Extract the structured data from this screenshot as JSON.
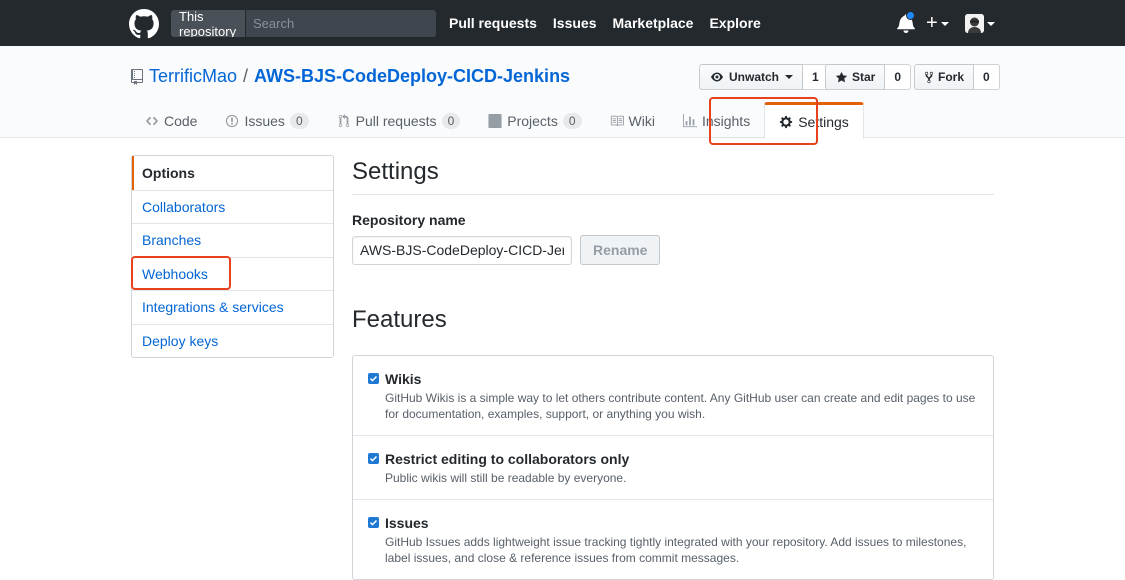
{
  "header": {
    "search_scope": "This repository",
    "search_placeholder": "Search",
    "nav": [
      "Pull requests",
      "Issues",
      "Marketplace",
      "Explore"
    ],
    "plus_label": "+"
  },
  "repo": {
    "owner": "TerrificMao",
    "separator": "/",
    "name": "AWS-BJS-CodeDeploy-CICD-Jenkins",
    "unwatch_label": "Unwatch",
    "watch_count": "1",
    "star_label": "Star",
    "star_count": "0",
    "fork_label": "Fork",
    "fork_count": "0"
  },
  "reponav": {
    "code": "Code",
    "issues": "Issues",
    "issues_count": "0",
    "pulls": "Pull requests",
    "pulls_count": "0",
    "projects": "Projects",
    "projects_count": "0",
    "wiki": "Wiki",
    "insights": "Insights",
    "settings": "Settings"
  },
  "sidebar": {
    "items": [
      {
        "label": "Options"
      },
      {
        "label": "Collaborators"
      },
      {
        "label": "Branches"
      },
      {
        "label": "Webhooks"
      },
      {
        "label": "Integrations & services"
      },
      {
        "label": "Deploy keys"
      }
    ]
  },
  "settings": {
    "title": "Settings",
    "repo_name_label": "Repository name",
    "repo_name_value": "AWS-BJS-CodeDeploy-CICD-Jenkins",
    "rename_label": "Rename",
    "features_title": "Features",
    "features": [
      {
        "title": "Wikis",
        "note": "GitHub Wikis is a simple way to let others contribute content. Any GitHub user can create and edit pages to use for documentation, examples, support, or anything you wish.",
        "checked": true
      },
      {
        "title": "Restrict editing to collaborators only",
        "note": "Public wikis will still be readable by everyone.",
        "checked": true
      },
      {
        "title": "Issues",
        "note": "GitHub Issues adds lightweight issue tracking tightly integrated with your repository. Add issues to milestones, label issues, and close & reference issues from commit messages.",
        "checked": true
      }
    ]
  },
  "colors": {
    "header_bg": "#24292e",
    "link": "#0366d6",
    "selected_accent": "#e36209",
    "annotation": "#e8411e"
  }
}
